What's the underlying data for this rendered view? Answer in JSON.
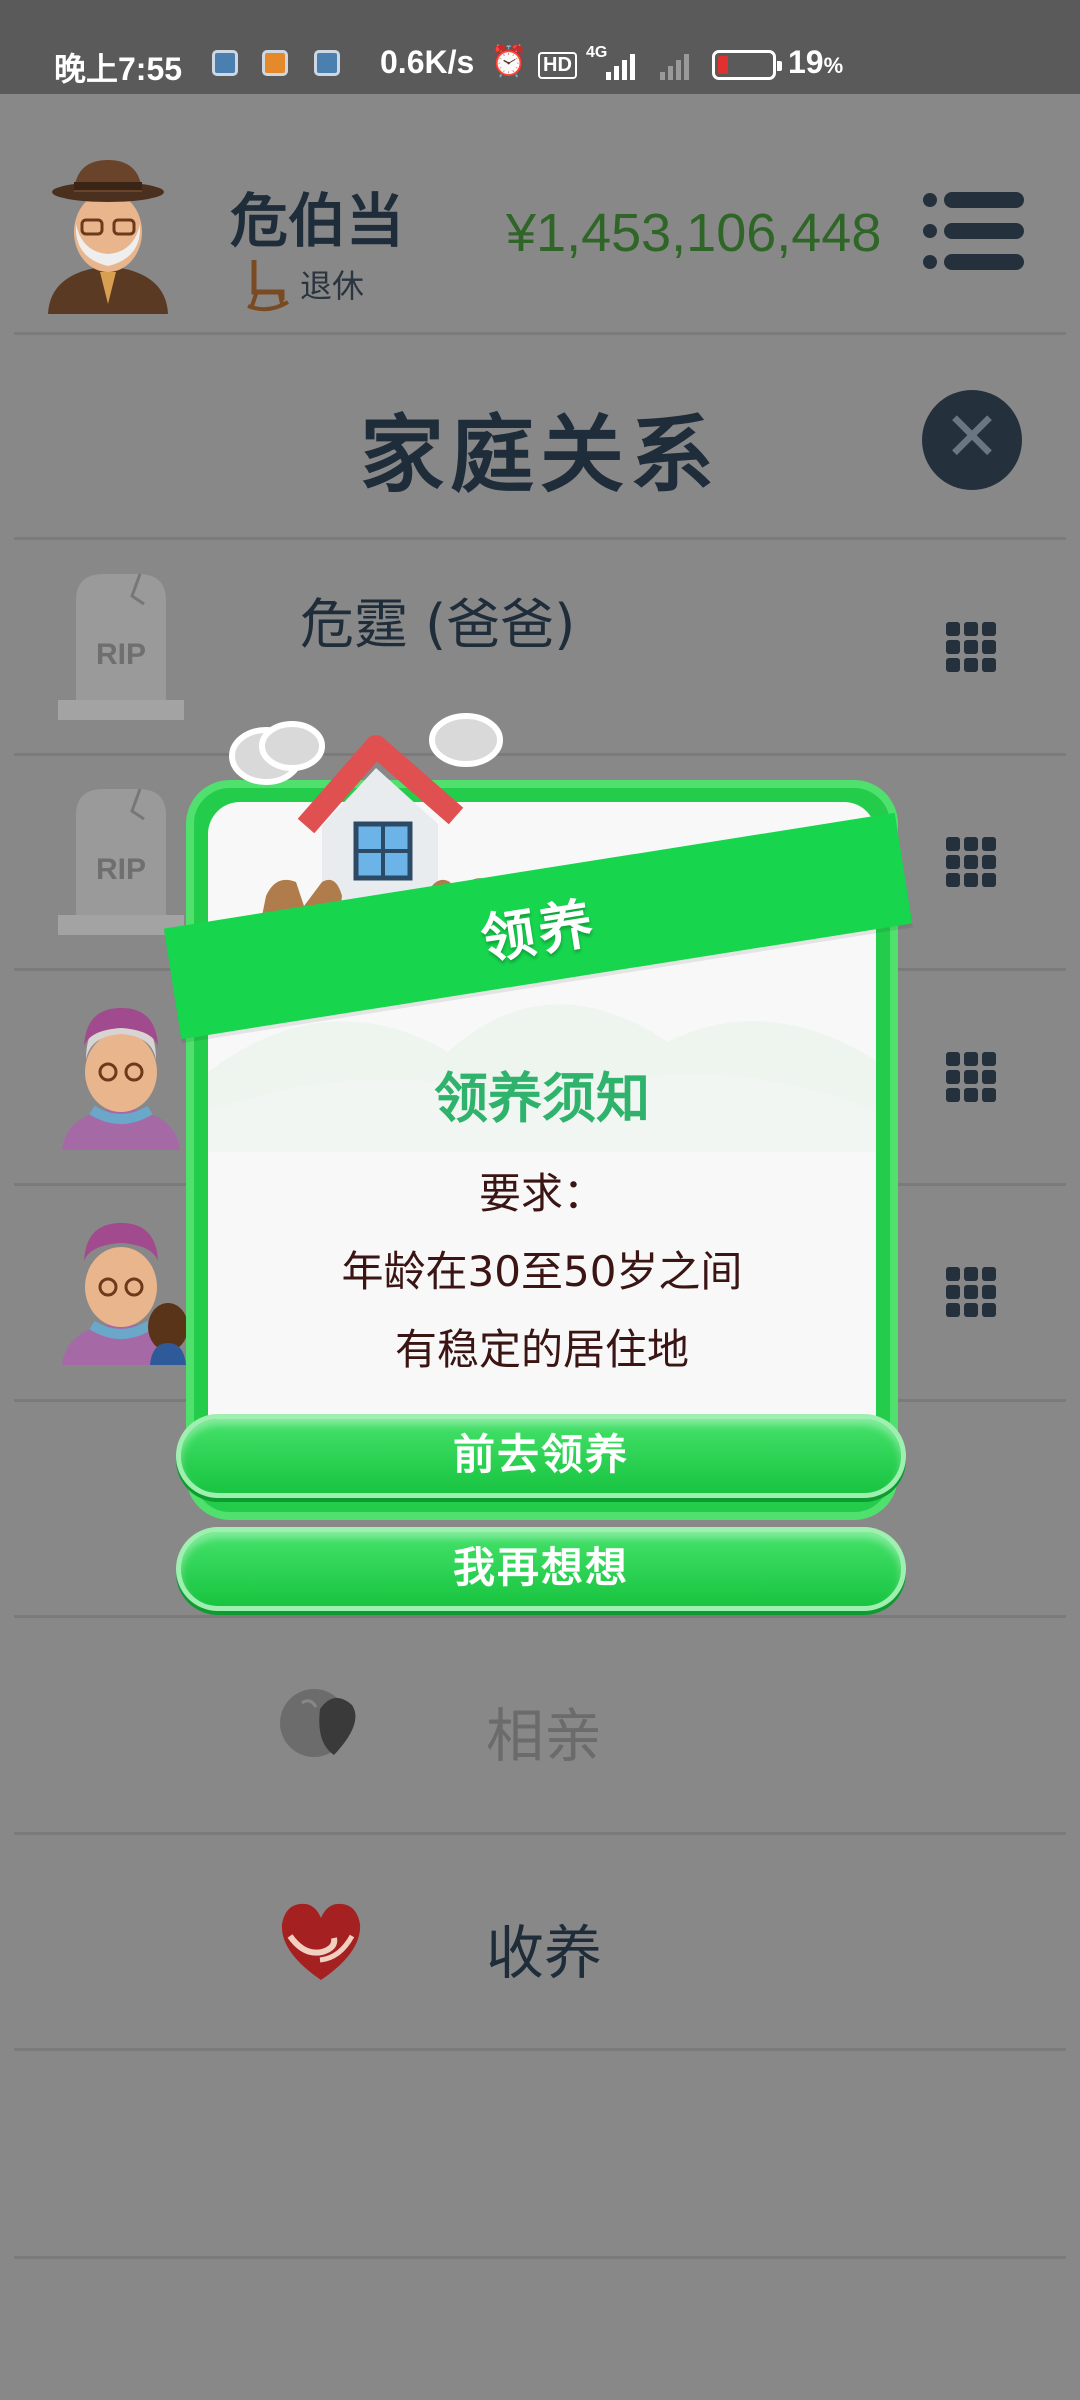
{
  "status_bar": {
    "time": "晚上7:55",
    "net_speed": "0.6K/s",
    "hd": "HD",
    "signal": "4G",
    "battery_pct": "19",
    "battery_unit": "%",
    "battery_level": 0.19
  },
  "header": {
    "player_name": "危伯当",
    "player_status": "退休",
    "money": "¥1,453,106,448"
  },
  "page_title": "家庭关系",
  "relatives": [
    {
      "label": "危霆 (爸爸)",
      "icon": "tombstone-icon",
      "rip": "RIP"
    },
    {
      "label": "",
      "icon": "tombstone-icon",
      "rip": "RIP"
    },
    {
      "label": "",
      "icon": "grandma-avatar"
    },
    {
      "label": "",
      "icon": "grandma-with-child-avatar"
    }
  ],
  "actions": [
    {
      "label": "相亲",
      "icon": "hearts-icon",
      "color": "#6b6b6b"
    },
    {
      "label": "收养",
      "icon": "hands-heart-icon",
      "color": "#1f2d3a"
    }
  ],
  "modal": {
    "ribbon": "领养",
    "title": "领养须知",
    "lines": [
      "要求：",
      "年龄在30至50岁之间",
      "有稳定的居住地"
    ],
    "confirm": "前去领养",
    "cancel": "我再想想"
  },
  "colors": {
    "overlay_bg": "#888888",
    "accent_green": "#17d64e",
    "money_green": "#2f6628",
    "title_green": "#2fb36c",
    "dark": "#1f2d3a"
  }
}
